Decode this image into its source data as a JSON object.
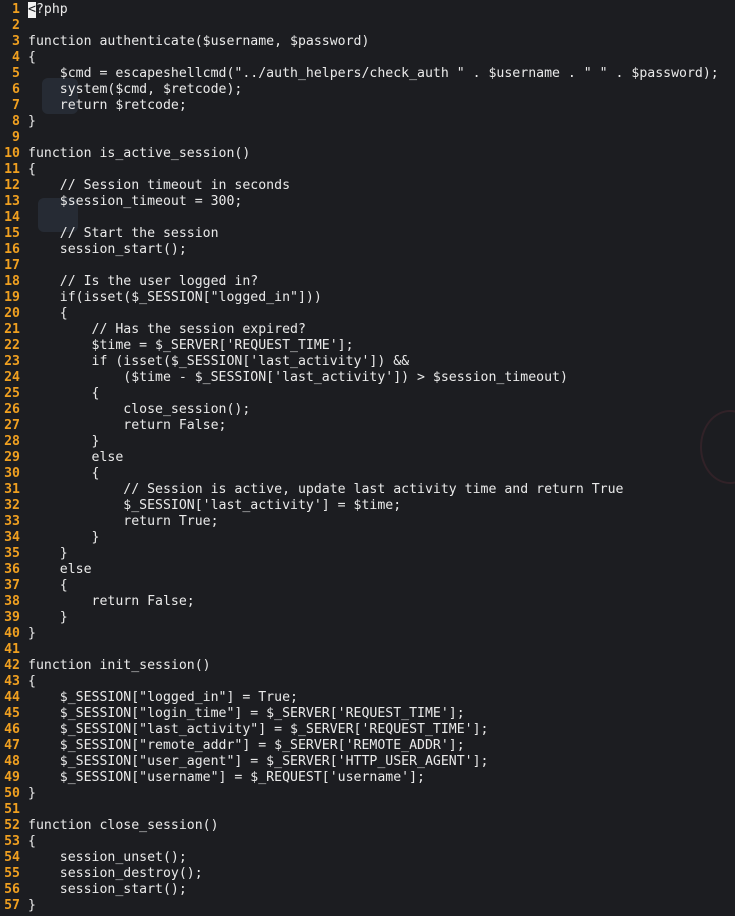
{
  "editor": {
    "cursor_char": "<",
    "colors": {
      "background": "#1c1d21",
      "line_number": "#f0a020",
      "text": "#eaeaea"
    },
    "lines": [
      {
        "n": "1",
        "text": "?php"
      },
      {
        "n": "2",
        "text": ""
      },
      {
        "n": "3",
        "text": "function authenticate($username, $password)"
      },
      {
        "n": "4",
        "text": "{"
      },
      {
        "n": "5",
        "text": "    $cmd = escapeshellcmd(\"../auth_helpers/check_auth \" . $username . \" \" . $password);"
      },
      {
        "n": "6",
        "text": "    system($cmd, $retcode);"
      },
      {
        "n": "7",
        "text": "    return $retcode;"
      },
      {
        "n": "8",
        "text": "}"
      },
      {
        "n": "9",
        "text": ""
      },
      {
        "n": "10",
        "text": "function is_active_session()"
      },
      {
        "n": "11",
        "text": "{"
      },
      {
        "n": "12",
        "text": "    // Session timeout in seconds"
      },
      {
        "n": "13",
        "text": "    $session_timeout = 300;"
      },
      {
        "n": "14",
        "text": ""
      },
      {
        "n": "15",
        "text": "    // Start the session"
      },
      {
        "n": "16",
        "text": "    session_start();"
      },
      {
        "n": "17",
        "text": ""
      },
      {
        "n": "18",
        "text": "    // Is the user logged in?"
      },
      {
        "n": "19",
        "text": "    if(isset($_SESSION[\"logged_in\"]))"
      },
      {
        "n": "20",
        "text": "    {"
      },
      {
        "n": "21",
        "text": "        // Has the session expired?"
      },
      {
        "n": "22",
        "text": "        $time = $_SERVER['REQUEST_TIME'];"
      },
      {
        "n": "23",
        "text": "        if (isset($_SESSION['last_activity']) &&"
      },
      {
        "n": "24",
        "text": "            ($time - $_SESSION['last_activity']) > $session_timeout)"
      },
      {
        "n": "25",
        "text": "        {"
      },
      {
        "n": "26",
        "text": "            close_session();"
      },
      {
        "n": "27",
        "text": "            return False;"
      },
      {
        "n": "28",
        "text": "        }"
      },
      {
        "n": "29",
        "text": "        else"
      },
      {
        "n": "30",
        "text": "        {"
      },
      {
        "n": "31",
        "text": "            // Session is active, update last activity time and return True"
      },
      {
        "n": "32",
        "text": "            $_SESSION['last_activity'] = $time;"
      },
      {
        "n": "33",
        "text": "            return True;"
      },
      {
        "n": "34",
        "text": "        }"
      },
      {
        "n": "35",
        "text": "    }"
      },
      {
        "n": "36",
        "text": "    else"
      },
      {
        "n": "37",
        "text": "    {"
      },
      {
        "n": "38",
        "text": "        return False;"
      },
      {
        "n": "39",
        "text": "    }"
      },
      {
        "n": "40",
        "text": "}"
      },
      {
        "n": "41",
        "text": ""
      },
      {
        "n": "42",
        "text": "function init_session()"
      },
      {
        "n": "43",
        "text": "{"
      },
      {
        "n": "44",
        "text": "    $_SESSION[\"logged_in\"] = True;"
      },
      {
        "n": "45",
        "text": "    $_SESSION[\"login_time\"] = $_SERVER['REQUEST_TIME'];"
      },
      {
        "n": "46",
        "text": "    $_SESSION[\"last_activity\"] = $_SERVER['REQUEST_TIME'];"
      },
      {
        "n": "47",
        "text": "    $_SESSION[\"remote_addr\"] = $_SERVER['REMOTE_ADDR'];"
      },
      {
        "n": "48",
        "text": "    $_SESSION[\"user_agent\"] = $_SERVER['HTTP_USER_AGENT'];"
      },
      {
        "n": "49",
        "text": "    $_SESSION[\"username\"] = $_REQUEST['username'];"
      },
      {
        "n": "50",
        "text": "}"
      },
      {
        "n": "51",
        "text": ""
      },
      {
        "n": "52",
        "text": "function close_session()"
      },
      {
        "n": "53",
        "text": "{"
      },
      {
        "n": "54",
        "text": "    session_unset();"
      },
      {
        "n": "55",
        "text": "    session_destroy();"
      },
      {
        "n": "56",
        "text": "    session_start();"
      },
      {
        "n": "57",
        "text": "}"
      }
    ]
  }
}
